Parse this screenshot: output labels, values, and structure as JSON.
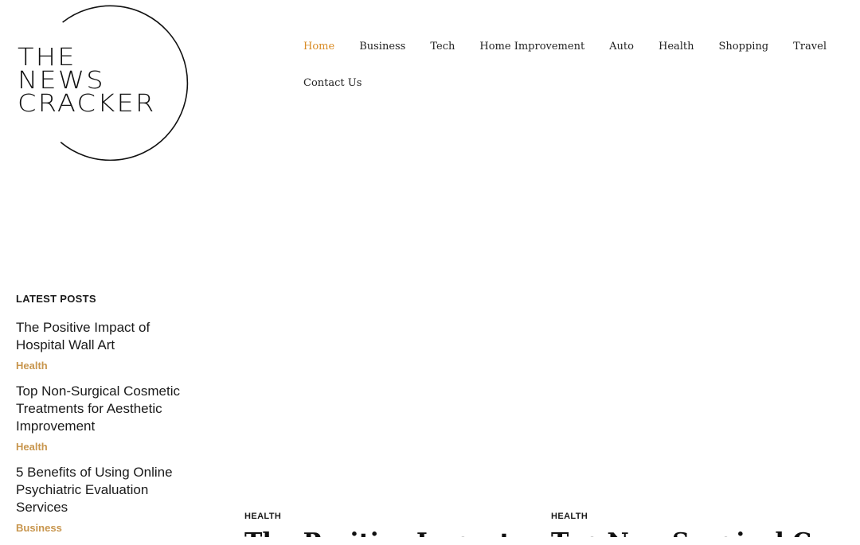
{
  "logo": {
    "line1": "THE",
    "line2": "NEWS",
    "line3": "CRACKER"
  },
  "nav": {
    "items": [
      {
        "label": "Home",
        "active": true
      },
      {
        "label": "Business"
      },
      {
        "label": "Tech"
      },
      {
        "label": "Home Improvement"
      },
      {
        "label": "Auto"
      },
      {
        "label": "Health"
      },
      {
        "label": "Shopping"
      },
      {
        "label": "Travel"
      },
      {
        "label": "Contact Us"
      }
    ]
  },
  "sidebar": {
    "heading": "LATEST POSTS",
    "posts": [
      {
        "title": "The Positive Impact of Hospital Wall Art",
        "category": "Health"
      },
      {
        "title": "Top Non-Surgical Cosmetic Treatments for Aesthetic Improvement",
        "category": "Health"
      },
      {
        "title": "5 Benefits of Using Online Psychiatric Evaluation Services",
        "category": "Business"
      }
    ]
  },
  "cards": [
    {
      "category": "HEALTH",
      "title": "The Positive Impact of Hospital Wall Art"
    },
    {
      "category": "HEALTH",
      "title": "Top Non-Surgical Cosmetic Treatments for Aesthetic Improvement"
    }
  ],
  "colors": {
    "accent": "#d98b25",
    "category": "#c8964e",
    "text": "#1a1a1a"
  }
}
